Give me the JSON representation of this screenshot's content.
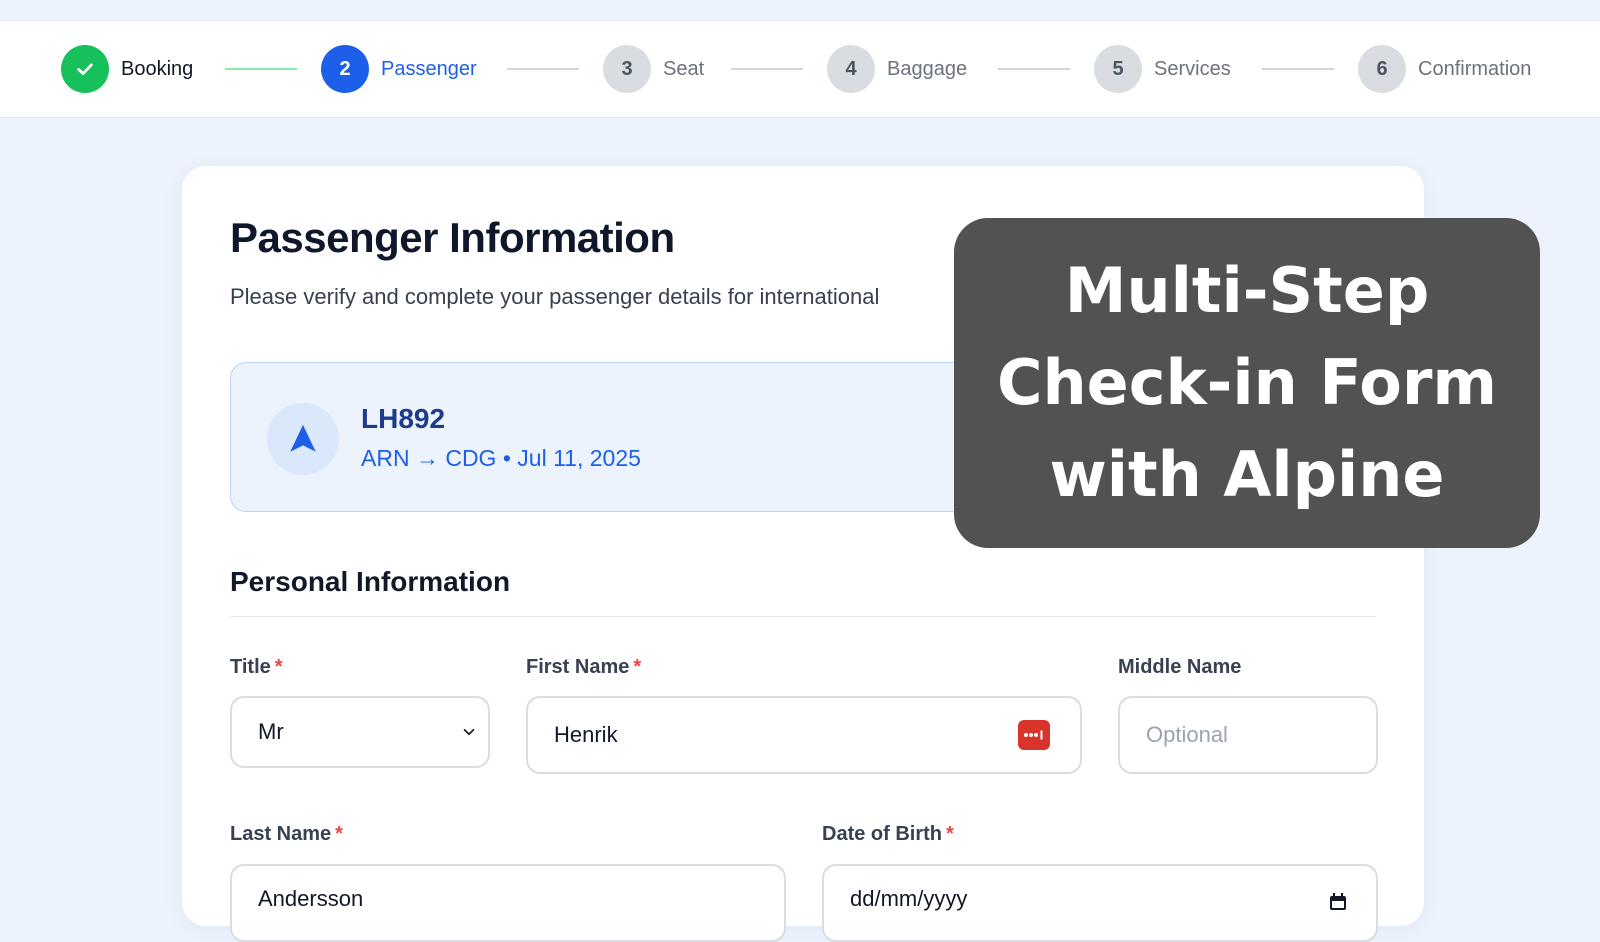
{
  "stepper": {
    "steps": [
      {
        "number": "1",
        "label": "Booking",
        "state": "done"
      },
      {
        "number": "2",
        "label": "Passenger",
        "state": "active"
      },
      {
        "number": "3",
        "label": "Seat",
        "state": "pending"
      },
      {
        "number": "4",
        "label": "Baggage",
        "state": "pending"
      },
      {
        "number": "5",
        "label": "Services",
        "state": "pending"
      },
      {
        "number": "6",
        "label": "Confirmation",
        "state": "pending"
      }
    ],
    "done_icon": "check-icon"
  },
  "page": {
    "title": "Passenger Information",
    "subtitle": "Please verify and complete your passenger details for international"
  },
  "flight": {
    "icon": "plane-icon",
    "number": "LH892",
    "route": "ARN → CDG • Jul 11, 2025"
  },
  "personal": {
    "section_title": "Personal Information",
    "title_field": {
      "label": "Title",
      "required_mark": "*",
      "value": "Mr"
    },
    "first_name": {
      "label": "First Name",
      "required_mark": "*",
      "value": "Henrik",
      "icon": "password-manager-icon"
    },
    "middle_name": {
      "label": "Middle Name",
      "placeholder": "Optional"
    },
    "last_name": {
      "label": "Last Name",
      "required_mark": "*",
      "value": "Andersson"
    },
    "dob": {
      "label": "Date of Birth",
      "required_mark": "*",
      "placeholder": "dd/mm/yyyy",
      "icon": "calendar-icon"
    }
  },
  "banner": {
    "lines": [
      "Multi-Step",
      "Check-in Form",
      "with Alpine"
    ]
  },
  "colors": {
    "primary": "#1d5fe8",
    "success": "#16c05a",
    "required": "#ef4444",
    "background": "#ecf3fc",
    "banner": "#525252"
  }
}
